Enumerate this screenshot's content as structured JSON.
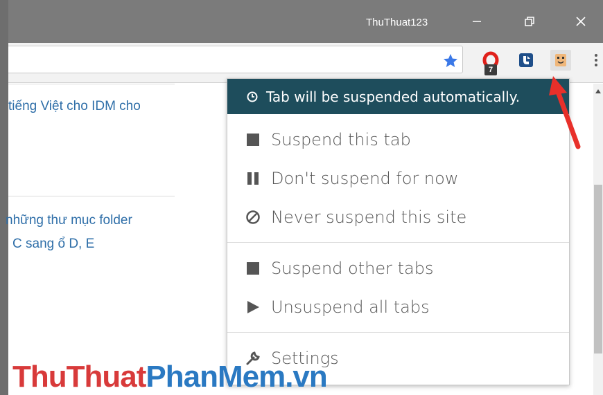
{
  "window": {
    "title": "ThuThuat123"
  },
  "toolbar": {
    "bookmark_icon": "star-icon",
    "extensions": [
      {
        "name": "opera-extension-icon",
        "badge": "7"
      },
      {
        "name": "save-extension-icon"
      },
      {
        "name": "great-suspender-icon"
      }
    ]
  },
  "page": {
    "line1": "tiếng Việt cho IDM cho",
    "line2": "những thư mục folder",
    "line3": "C sang ổ D, E"
  },
  "popup": {
    "header": "Tab will be suspended automatically.",
    "items": [
      {
        "label": "Suspend this tab",
        "icon": "square-icon"
      },
      {
        "label": "Don't suspend for now",
        "icon": "pause-icon"
      },
      {
        "label": "Never suspend this site",
        "icon": "block-icon"
      },
      {
        "label": "Suspend other tabs",
        "icon": "square-icon"
      },
      {
        "label": "Unsuspend all tabs",
        "icon": "play-icon"
      },
      {
        "label": "Settings",
        "icon": "wrench-icon"
      }
    ]
  },
  "watermark": {
    "part1": "ThuThuat",
    "part2": "PhanMem.vn"
  },
  "colors": {
    "popup_header": "#1e4d5c",
    "link_text": "#2e6ea8",
    "arrow": "#e8302a",
    "watermark_red": "#d83a3a",
    "watermark_blue": "#2a79c2"
  }
}
